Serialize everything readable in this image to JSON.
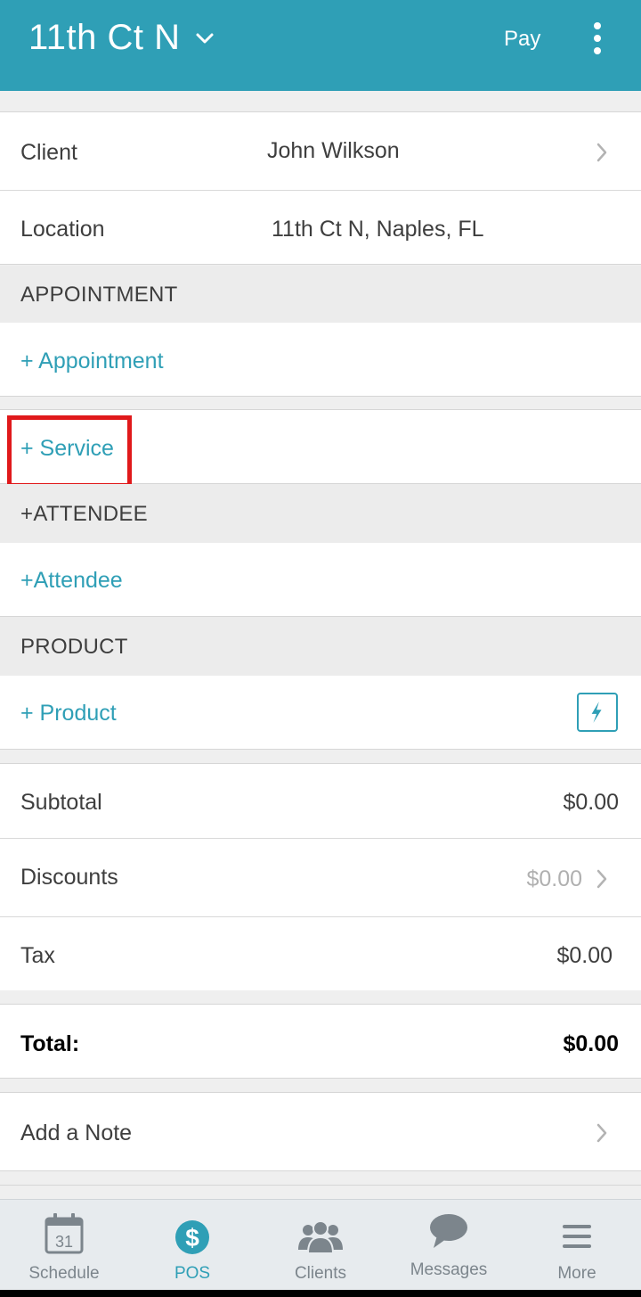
{
  "header": {
    "title": "11th Ct N",
    "pay_label": "Pay",
    "brand_color": "#2f9fb6"
  },
  "details": {
    "client_label": "Client",
    "client_value": "John Wilkson",
    "location_label": "Location",
    "location_value": "11th Ct N, Naples, FL"
  },
  "appointment": {
    "header": "APPOINTMENT",
    "add_appointment": "+ Appointment",
    "add_service": "+ Service"
  },
  "attendee": {
    "header": "+ATTENDEE",
    "add_attendee": "+Attendee"
  },
  "product": {
    "header": "PRODUCT",
    "add_product": "+ Product",
    "quick_icon": "lightning-bolt-icon"
  },
  "totals": {
    "subtotal_label": "Subtotal",
    "subtotal_value": "$0.00",
    "discounts_label": "Discounts",
    "discounts_value": "$0.00",
    "tax_label": "Tax",
    "tax_value": "$0.00",
    "total_label": "Total:",
    "total_value": "$0.00"
  },
  "note": {
    "label": "Add a Note"
  },
  "tabs": [
    {
      "label": "Schedule",
      "icon": "calendar-icon",
      "calendar_day": "31"
    },
    {
      "label": "POS",
      "icon": "dollar-icon",
      "glyph": "$"
    },
    {
      "label": "Clients",
      "icon": "clients-icon"
    },
    {
      "label": "Messages",
      "icon": "chat-bubble-icon"
    },
    {
      "label": "More",
      "icon": "hamburger-menu-icon"
    }
  ]
}
